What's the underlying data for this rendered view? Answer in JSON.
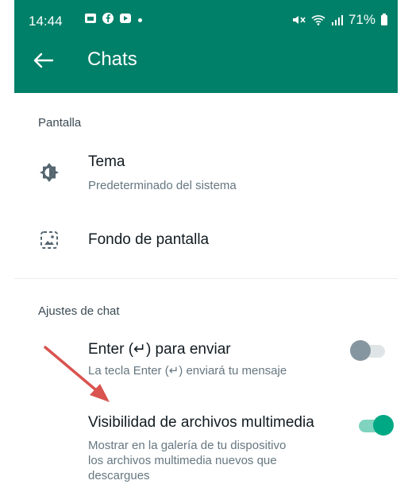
{
  "status": {
    "time": "14:44",
    "battery": "71%",
    "icons_left": [
      "gallery-icon",
      "facebook-icon",
      "youtube-icon"
    ],
    "icons_right": [
      "mute-icon",
      "wifi-icon",
      "signal-icon",
      "battery-icon"
    ]
  },
  "header": {
    "title": "Chats",
    "back_icon": "arrow-left-icon"
  },
  "sections": {
    "display": {
      "heading": "Pantalla",
      "theme": {
        "title": "Tema",
        "subtitle": "Predeterminado del sistema",
        "icon": "brightness-icon"
      },
      "wallpaper": {
        "title": "Fondo de pantalla",
        "icon": "wallpaper-icon"
      }
    },
    "chat": {
      "heading": "Ajustes de chat",
      "enter_send": {
        "title": "Enter (↵) para enviar",
        "subtitle": "La tecla Enter (↵) enviará tu mensaje",
        "enabled": false
      },
      "media_visibility": {
        "title": "Visibilidad de archivos multimedia",
        "subtitle_lines": [
          "Mostrar en la galería de tu dispositivo",
          "los archivos multimedia nuevos que",
          "descargues"
        ],
        "enabled": true
      }
    }
  },
  "colors": {
    "header": "#008069",
    "toggle_on": "#00a884",
    "toggle_off_knob": "#8696a0",
    "annotation_arrow": "#d9534f"
  }
}
